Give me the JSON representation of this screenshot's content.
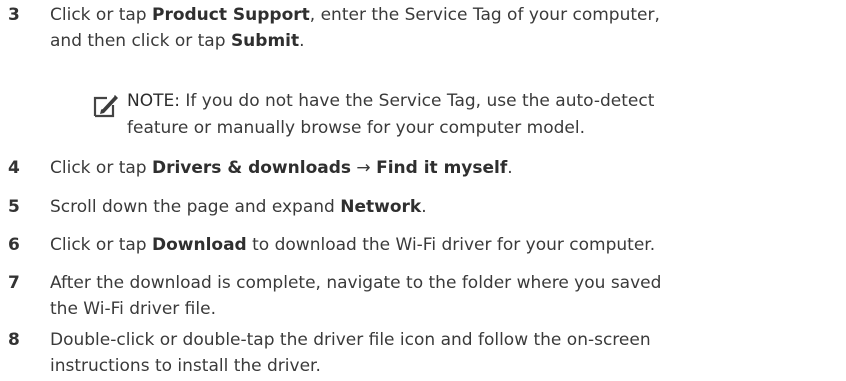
{
  "steps": [
    {
      "number": "3",
      "line1_a": "Click or tap ",
      "line1_b": "Product Support",
      "line1_c": ", enter the Service Tag of your computer,",
      "line2_a": "and then click or tap ",
      "line2_b": "Submit",
      "line2_c": "."
    },
    {
      "number": "4",
      "a": "Click or tap ",
      "b": "Drivers & downloads",
      "c": " → ",
      "d": "Find it myself",
      "e": "."
    },
    {
      "number": "5",
      "a": "Scroll down the page and expand ",
      "b": "Network",
      "c": "."
    },
    {
      "number": "6",
      "a": "Click or tap ",
      "b": "Download",
      "c": " to download the Wi-Fi driver for your computer."
    },
    {
      "number": "7",
      "line1": "After the download is complete, navigate to the folder where you saved",
      "line2": "the Wi-Fi driver file."
    },
    {
      "number": "8",
      "line1": "Double-click or double-tap the driver file icon and follow the on-screen",
      "line2": "instructions to install the driver."
    }
  ],
  "note": {
    "label": "NOTE:",
    "line1": " If you do not have the Service Tag, use the auto-detect",
    "line2": "feature or manually browse for your computer model.",
    "icon": "pencil-note-icon"
  }
}
